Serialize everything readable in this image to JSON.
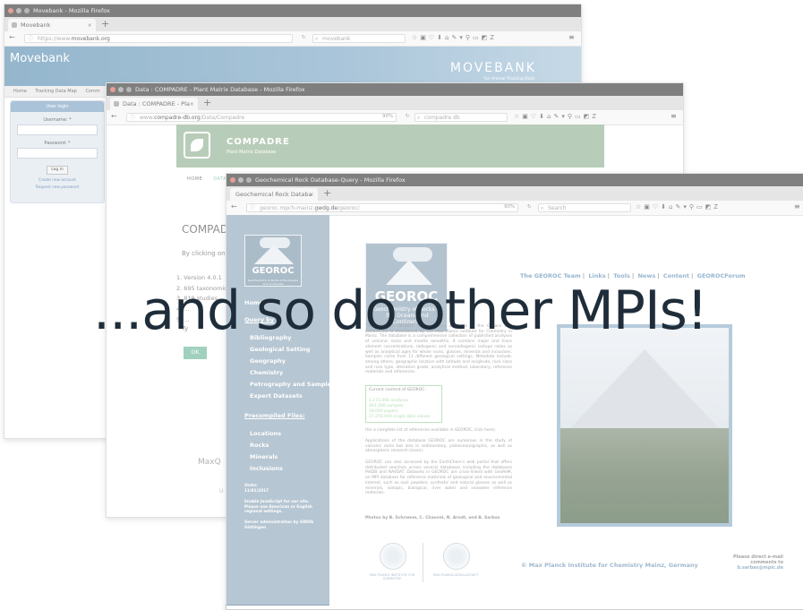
{
  "movebank": {
    "window_title": "Movebank - Mozilla Firefox",
    "tab": "Movebank",
    "url_host": "https://www.",
    "url_domain": "movebank.org",
    "search": "movebank",
    "site_title": "Movebank",
    "logo": "MOVEBANK",
    "tagline": "For Animal Tracking Data",
    "nav": [
      "Home",
      "Tracking Data Map",
      "Comm"
    ],
    "login": {
      "header": "User login",
      "username": "Username: *",
      "password": "Password: *",
      "button": "Log in",
      "links": [
        "Create new account",
        "Request new password"
      ]
    }
  },
  "compadre": {
    "window_title": "Data : COMPADRE - Plant Matrix Database - Mozilla Firefox",
    "tab": "Data : COMPADRE - Pla",
    "url_host": "www.",
    "url_domain": "compadre-db.org",
    "url_path": "/Data/Compadre",
    "zoom": "90%",
    "search": "compadre db",
    "brand": "COMPADRE",
    "brand_sub": "Plant Matrix Database",
    "nav": [
      "HOME",
      "DATA"
    ],
    "heading": "COMPAD",
    "intro": "By clicking on \"",
    "list": [
      "1. Version 4.0.1",
      "2. 695 taxonomic",
      "3. 819 studies",
      "4. ...",
      "5. ..."
    ],
    "type_label": "Ty",
    "ok": "OK",
    "footer_logo": "MaxQ",
    "footer_u": "U"
  },
  "georoc": {
    "window_title": "Geochemical Rock Database-Query - Mozilla Firefox",
    "tab": "Geochemical Rock Databa",
    "url_host": "georoc.mpch-mainz.",
    "url_domain": "gwdg.de",
    "url_path": "/georoc/",
    "zoom": "90%",
    "search": "Search",
    "logo_title": "GEOROC",
    "logo_sub": "Geochemistry of Rocks of the Oceans and Continents",
    "menu": {
      "home": "Home",
      "query": "Query by",
      "items": [
        "Bibliography",
        "Geological Setting",
        "Geography",
        "Chemistry",
        "Petrography and Samples",
        "Expert Datasets"
      ],
      "precompiled": "Precompiled Files:",
      "files": [
        "Locations",
        "Rocks",
        "Minerals",
        "Inclusions"
      ]
    },
    "state_label": "State:",
    "state_date": "11/01/2017",
    "js_note": "Enable JavaScript for our site. Please use American or English regional settings.",
    "admin": "Server administration by GWDG Göttingen",
    "links": [
      "The GEOROC Team",
      "Links",
      "Tools",
      "News",
      "Content",
      "GEOROCForum"
    ],
    "about": "The database GEOROC (Geochemistry of Rocks of the Oceans and Continents) is maintained by the Max Planck Institute for Chemistry in Mainz. The database is a comprehensive collection of published analyses of volcanic rocks and mantle xenoliths. It contains major and trace element concentrations, radiogenic and nonradiogenic isotope ratios as well as analytical ages for whole rocks, glasses, minerals and inclusions. Samples come from 11 different geological settings. Metadata include, among others, geographic location with latitude and longitude, rock class and rock type, alteration grade, analytical method, laboratory, reference materials and references.",
    "content_box": {
      "title": "Current content of GEOROC:",
      "lines": [
        "1,173,000 analyses",
        "491,500 samples",
        "18,000 papers",
        "17,250,000 single data values"
      ]
    },
    "refs_note": "(for a complete list of references available in GEOROC, click here).",
    "applications": "Applications of the database GEOROC are numerous in the study of volcanic rocks but also in sedimentary, paleoceanographic, as well as atmospheric research (more).",
    "earthchem": "GEOROC can also accessed by the EarthChem's web portal that offers distributed searches across several databases including the databases PetDB and NAVDAT. Datasets in GEOROC are cross-linked with GeoReM, an MPI database for reference materials of geological and environmental interest, such as rock powders, synthetic and natural glasses as well as minerals, isotopic, biological, river water and seawater reference materials.",
    "photo_credit": "Photos by B. Schramm, C. Chauvel, N. Arndt, and B. Sarbas",
    "mpi_chem": "MAX PLANCK INSTITUTE FOR CHEMISTRY",
    "mpg": "MAX-PLANCK-GESELLSCHAFT",
    "copyright": "© Max Planck Institute for Chemistry Mainz, Germany",
    "contact": "Please direct e-mail comments to",
    "contact_email": "b.sarbas@mpic.de"
  },
  "caption": "...and so do other MPIs!"
}
